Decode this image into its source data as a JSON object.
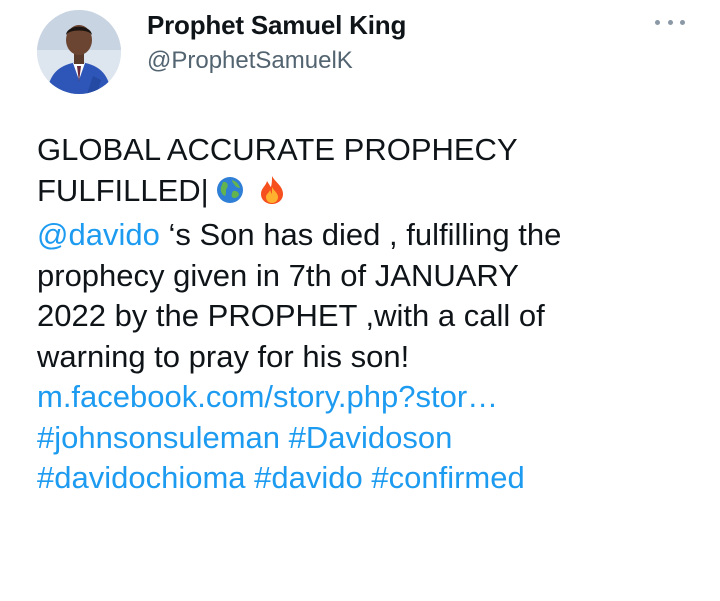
{
  "author": {
    "display_name": "Prophet Samuel King",
    "handle": "@ProphetSamuelK"
  },
  "menu": {
    "icon": "more-horizontal-icon"
  },
  "tweet": {
    "headline_line1": "GLOBAL ACCURATE PROPHECY",
    "headline_line2": "FULFILLED|",
    "emojis": [
      "globe-emoji",
      "fire-emoji"
    ],
    "mention": "@davido",
    "line3_rest": " ‘s Son has died , fulfilling the",
    "line4": "prophecy given in  7th of JANUARY",
    "line5": "2022 by the PROPHET ,with a call of",
    "line6": "warning to pray for his son!",
    "url": "m.facebook.com/story.php?stor…",
    "hashtags_line1": [
      "#johnsonsuleman",
      "#Davidoson"
    ],
    "hashtags_line2": [
      "#davidochioma",
      "#davido",
      "#confirmed"
    ]
  },
  "colors": {
    "text": "#0f1419",
    "secondary": "#536471",
    "link": "#1d9bf0"
  }
}
